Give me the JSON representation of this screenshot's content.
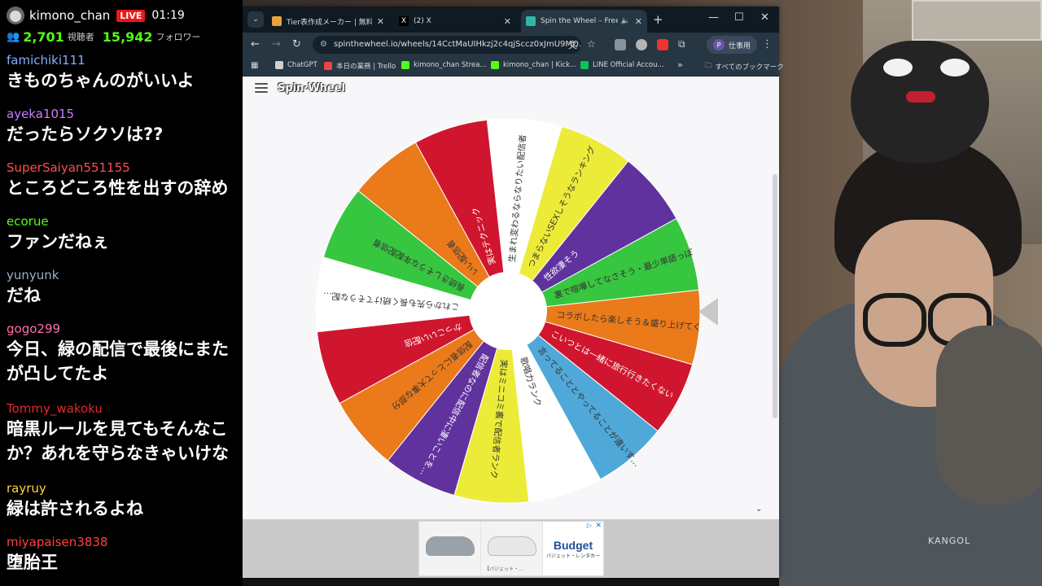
{
  "chat": {
    "channel_name": "kimono_chan",
    "live_label": "LIVE",
    "stream_time": "01:19",
    "viewers": "2,701",
    "viewers_label": "視聴者",
    "followers": "15,942",
    "followers_label": "フォロワー",
    "messages": [
      {
        "user": "famichiki111",
        "user_color": "#7fb2ff",
        "text": "きものちゃんのがいいよ"
      },
      {
        "user": "ayeka1015",
        "user_color": "#c77dff",
        "text": "だったらソクソは??"
      },
      {
        "user": "SuperSaiyan551155",
        "user_color": "#ff4d4d",
        "text": "ところどころ性を出すの辞め"
      },
      {
        "user": "ecorue",
        "user_color": "#53fc18",
        "text": "ファンだねぇ"
      },
      {
        "user": "yunyunk",
        "user_color": "#9ab0c8",
        "text": "だね"
      },
      {
        "user": "gogo299",
        "user_color": "#ff6fae",
        "text": "今日、緑の配信で最後にまた",
        "text2": "が凸してたよ"
      },
      {
        "user": "Tommy_wakoku",
        "user_color": "#e0282c",
        "text": "暗黒ルールを見てもそんなこ",
        "text2": "か？あれを守らなきゃいけな"
      },
      {
        "user": "rayruy",
        "user_color": "#ffd23f",
        "text": "緑は許されるよね"
      },
      {
        "user": "miyapaisen3838",
        "user_color": "#ff4040",
        "text": "堕胎王"
      }
    ]
  },
  "browser": {
    "tabs": [
      {
        "title": "Tier表作成メーカー | 無料でティ",
        "fav_color": "#e8a33d"
      },
      {
        "title": "(2) X",
        "fav_color": "#000000"
      },
      {
        "title": "Spin the Wheel – Free W",
        "fav_color": "#2fb7a8"
      }
    ],
    "url": "spinthewheel.io/wheels/14CctMaUIHkzj2c4qjSccz0xJmU9MQ...",
    "profile_label": "仕事用",
    "profile_initial": "P",
    "bookmarks": [
      {
        "label": "ChatGPT",
        "color": "#cfcfcf"
      },
      {
        "label": "本日の業務 | Trello",
        "color": "#e44"
      },
      {
        "label": "kimono_chan Strea...",
        "color": "#53fc18"
      },
      {
        "label": "kimono_chan | Kick...",
        "color": "#53fc18"
      },
      {
        "label": "LINE Official Accou...",
        "color": "#06c755"
      }
    ],
    "bookmarks_more": "»",
    "all_bookmarks": "すべてのブックマーク"
  },
  "page": {
    "logo": "Spin·Wheel",
    "wheel_segments": [
      {
        "label": "生まれ変わるならなりたい配信者",
        "color": "#ffffff",
        "text_color": "#333"
      },
      {
        "label": "つまらないSEXしそうなランキング",
        "color": "#ecec38",
        "text_color": "#333"
      },
      {
        "label": "性欲凄そう",
        "color": "#60329e",
        "text_color": "#fff"
      },
      {
        "label": "裏で喧嘩してなさそう・最少単語っぽ",
        "color": "#37c63f",
        "text_color": "#333"
      },
      {
        "label": "コラボしたら楽しそう＆盛り上げてく…",
        "color": "#ea7a1a",
        "text_color": "#333"
      },
      {
        "label": "こいつとは一緒に旅行行きたくない",
        "color": "#d0162e",
        "text_color": "#fff"
      },
      {
        "label": "言ってることとやってることが違いす…",
        "color": "#4fa8d8",
        "text_color": "#333"
      },
      {
        "label": "歌唱力ランク",
        "color": "#ffffff",
        "text_color": "#333"
      },
      {
        "label": "実はミニコミ裏で配信者ランク",
        "color": "#ecec38",
        "text_color": "#333"
      },
      {
        "label": "配信者なのに配信中に凄いことを…",
        "color": "#60329e",
        "text_color": "#fff"
      },
      {
        "label": "配信者にとって大事な部分",
        "color": "#ea7a1a",
        "text_color": "#333"
      },
      {
        "label": "かっこいい配信",
        "color": "#d0162e",
        "text_color": "#fff"
      },
      {
        "label": "これから先も長く続けてそうな配…",
        "color": "#ffffff",
        "text_color": "#333"
      },
      {
        "label": "長続きしそうな年配配信者",
        "color": "#37c63f",
        "text_color": "#333"
      },
      {
        "label": "いい配信者",
        "color": "#ea7a1a",
        "text_color": "#333"
      },
      {
        "label": "実はテクニック",
        "color": "#d0162e",
        "text_color": "#fff"
      }
    ]
  },
  "ad": {
    "caption1": "",
    "caption2": "【バジェット・…",
    "brand": "Budget",
    "brand_sub": "バジェット・レンタカー",
    "close": "✕",
    "info": "▷"
  }
}
